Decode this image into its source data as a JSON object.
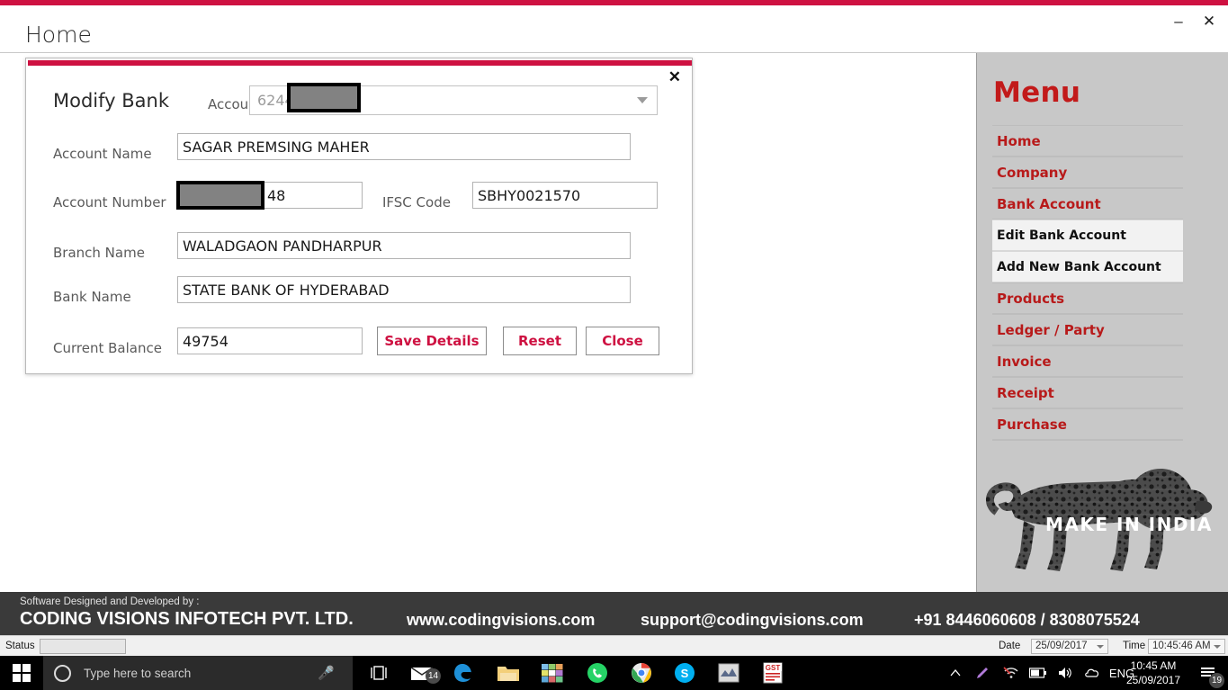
{
  "window": {
    "title": "Home",
    "minimize_label": "–",
    "close_label": "✕",
    "accent_color": "#ce1141"
  },
  "dialog": {
    "title": "Modify Bank",
    "close_label": "✕",
    "account_label": "Account",
    "account_value": "6244",
    "fields": [
      {
        "label": "Account Name",
        "value": "SAGAR PREMSING MAHER"
      },
      {
        "label": "Account Number",
        "value": "48"
      },
      {
        "label": "IFSC Code",
        "value": "SBHY0021570"
      },
      {
        "label": "Branch Name",
        "value": "WALADGAON PANDHARPUR"
      },
      {
        "label": "Bank Name",
        "value": "STATE BANK OF HYDERABAD"
      },
      {
        "label": "Current Balance",
        "value": "49754"
      }
    ],
    "buttons": [
      {
        "label": "Save Details"
      },
      {
        "label": "Reset"
      },
      {
        "label": "Close"
      }
    ]
  },
  "menu": {
    "title": "Menu",
    "title_color": "#c21a1a",
    "items": [
      {
        "label": "Home",
        "type": "main"
      },
      {
        "label": "Company",
        "type": "main"
      },
      {
        "label": "Bank Account",
        "type": "main"
      },
      {
        "label": "Edit Bank Account",
        "type": "sub"
      },
      {
        "label": "Add New Bank Account",
        "type": "sub"
      },
      {
        "label": "Products",
        "type": "main"
      },
      {
        "label": "Ledger / Party",
        "type": "main"
      },
      {
        "label": "Invoice",
        "type": "main"
      },
      {
        "label": "Receipt",
        "type": "main"
      },
      {
        "label": "Purchase",
        "type": "main"
      }
    ],
    "logo_text": "MAKE IN INDIA"
  },
  "footer": {
    "designed_by": "Software Designed and Developed by :",
    "company": "CODING VISIONS INFOTECH PVT. LTD.",
    "website": "www.codingvisions.com",
    "email": "support@codingvisions.com",
    "phone": "+91 8446060608 / 8308075524"
  },
  "statusbar": {
    "status_label": "Status",
    "status_value": "",
    "date_label": "Date",
    "date_value": "25/09/2017",
    "time_label": "Time",
    "time_value": "10:45:46 AM"
  },
  "taskbar": {
    "search_placeholder": "Type here to search",
    "search_value": "",
    "mail_badge": "14",
    "language": "ENG",
    "clock_time": "10:45 AM",
    "clock_date": "25/09/2017",
    "notification_count": "19",
    "app_names": [
      "task-view",
      "mail",
      "edge",
      "file-explorer",
      "photos",
      "whatsapp",
      "chrome",
      "skype",
      "winamp",
      "gst"
    ]
  }
}
